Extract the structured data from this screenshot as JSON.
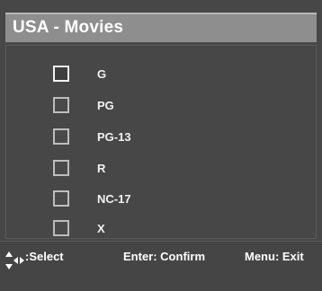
{
  "header": {
    "title": "USA - Movies"
  },
  "ratings": [
    {
      "label": "G",
      "checked": false,
      "focused": true
    },
    {
      "label": "PG",
      "checked": false,
      "focused": false
    },
    {
      "label": "PG-13",
      "checked": false,
      "focused": false
    },
    {
      "label": "R",
      "checked": false,
      "focused": false
    },
    {
      "label": "NC-17",
      "checked": false,
      "focused": false
    },
    {
      "label": "X",
      "checked": false,
      "focused": false
    }
  ],
  "footer": {
    "select_hint": ":Select",
    "confirm_hint": "Enter: Confirm",
    "exit_hint": "Menu: Exit",
    "nav_icon": "arrow-keys-icon"
  },
  "colors": {
    "background": "#474747",
    "title_bar": "#8e8e8e",
    "text": "#ffffff",
    "checkbox_border": "#bdbdbd"
  }
}
